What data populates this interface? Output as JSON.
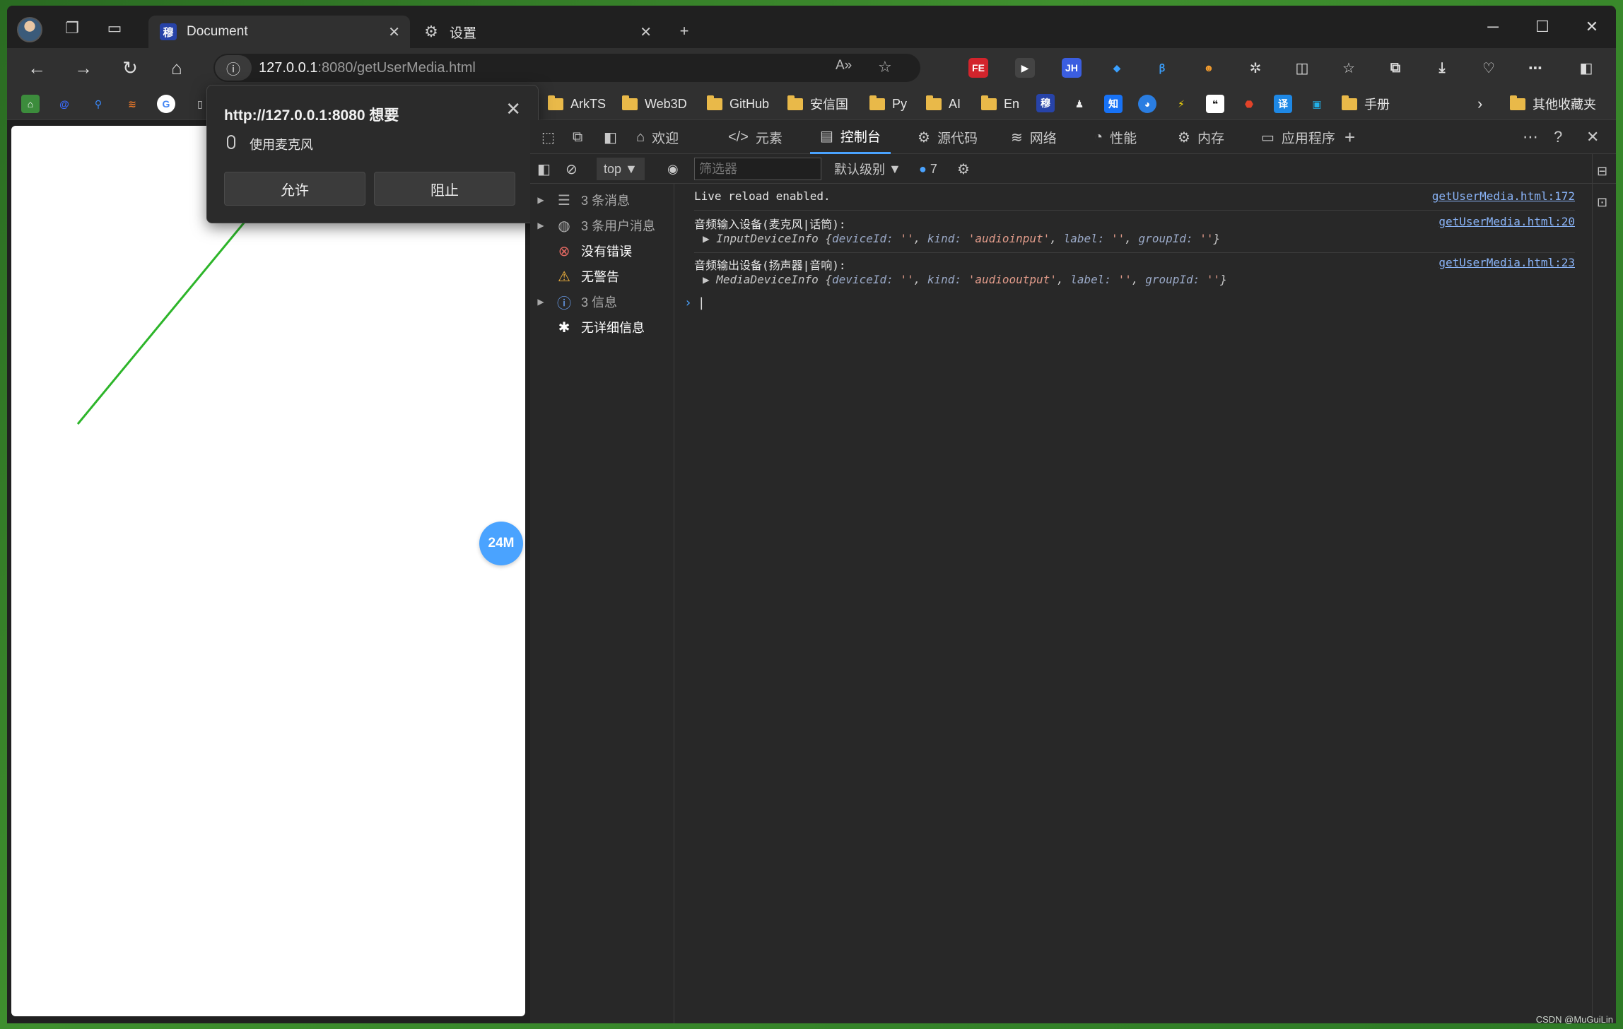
{
  "tabs": [
    {
      "title": "Document",
      "favicon": "穆"
    },
    {
      "title": "设置"
    }
  ],
  "address": {
    "host": "127.0.0.1",
    "rest": ":8080/getUserMedia.html"
  },
  "bookmarks": [
    "ArkTS",
    "Web3D",
    "GitHub",
    "安信国",
    "Py",
    "AI",
    "En",
    "手册"
  ],
  "bookmark_other": "其他收藏夹",
  "permission": {
    "title": "http://127.0.0.1:8080 想要",
    "request": "使用麦克风",
    "allow": "允许",
    "block": "阻止"
  },
  "page": {
    "bubble": "24M"
  },
  "devtools": {
    "tabs": [
      "欢迎",
      "元素",
      "控制台",
      "源代码",
      "网络",
      "性能",
      "内存",
      "应用程序"
    ],
    "context": "top",
    "filter_placeholder": "筛选器",
    "levels": "默认级别",
    "issue_count": "7",
    "sidebar": [
      {
        "label": "3 条消息",
        "expandable": true
      },
      {
        "label": "3 条用户消息",
        "expandable": true
      },
      {
        "label": "没有错误",
        "expandable": false
      },
      {
        "label": "无警告",
        "expandable": false
      },
      {
        "label": "3 信息",
        "expandable": true
      },
      {
        "label": "无详细信息",
        "expandable": false
      }
    ],
    "messages": [
      {
        "text": "Live reload enabled.",
        "source": "getUserMedia.html:172"
      },
      {
        "text": "音频输入设备(麦克风|话筒):",
        "source": "getUserMedia.html:20",
        "object": {
          "name": "InputDeviceInfo",
          "deviceId": "''",
          "kind": "'audioinput'",
          "label": "''",
          "groupId": "''"
        }
      },
      {
        "text": "音频输出设备(扬声器|音响):",
        "source": "getUserMedia.html:23",
        "object": {
          "name": "MediaDeviceInfo",
          "deviceId": "''",
          "kind": "'audiooutput'",
          "label": "''",
          "groupId": "''"
        }
      }
    ]
  },
  "watermark": "CSDN @MuGuiLin",
  "colors": {
    "accent": "#4aa3ff",
    "arrow": "#2db52a"
  }
}
